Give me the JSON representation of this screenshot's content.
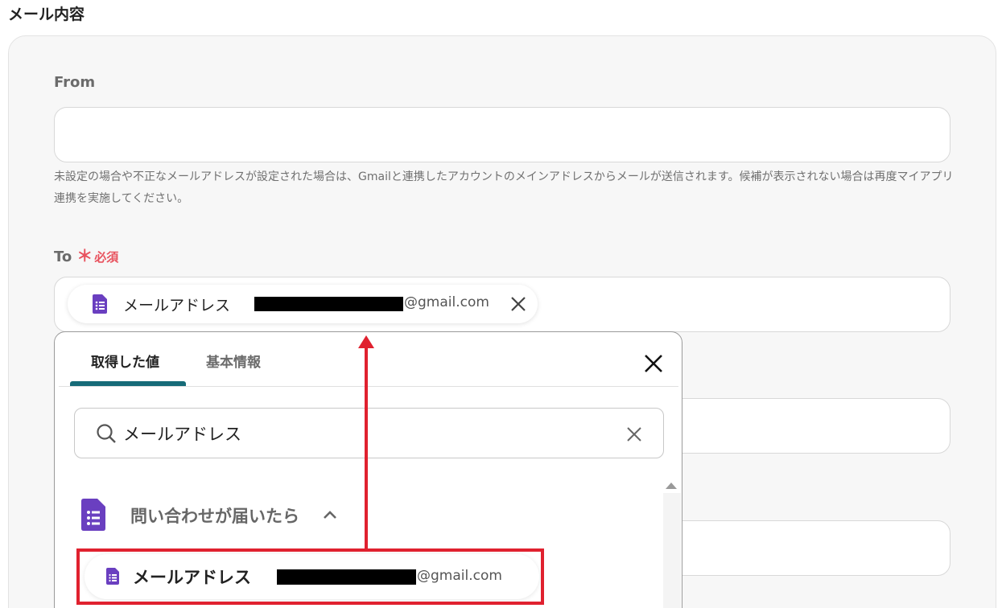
{
  "section_title": "メール内容",
  "from": {
    "label": "From",
    "value": "",
    "help": "未設定の場合や不正なメールアドレスが設定された場合は、Gmailと連携したアカウントのメインアドレスからメールが送信されます。候補が表示されない場合は再度マイアプリ連携を実施してください。"
  },
  "to": {
    "label": "To",
    "required_star": "＊",
    "required_text": "必須",
    "chip": {
      "label": "メールアドレス",
      "suffix": "@gmail.com"
    }
  },
  "popup": {
    "tabs": [
      {
        "label": "取得した値",
        "active": true
      },
      {
        "label": "基本情報",
        "active": false
      }
    ],
    "search": {
      "value": "メールアドレス"
    },
    "group": {
      "title": "問い合わせが届いたら"
    },
    "result": {
      "label": "メールアドレス",
      "suffix": "@gmail.com"
    }
  },
  "colors": {
    "accent_tab": "#166b78",
    "required": "#e8525e",
    "annotation": "#e0212f",
    "form_icon": "#6a3fc0"
  }
}
